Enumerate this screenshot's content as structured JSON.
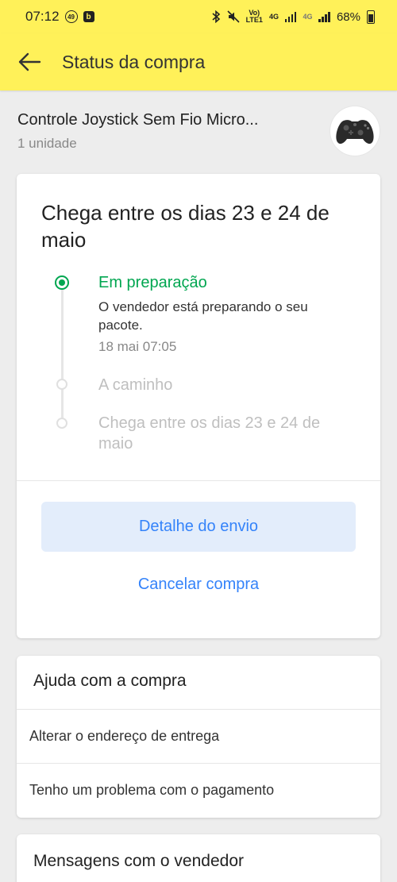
{
  "status_bar": {
    "time": "07:12",
    "notif_count": "49",
    "network_volte": "Vo)",
    "network_lte": "LTE1",
    "network_4g": "4G",
    "network_4g_secondary": "4G",
    "battery": "68%"
  },
  "header": {
    "title": "Status da compra",
    "background_color": "#fff159"
  },
  "product": {
    "name": "Controle Joystick Sem Fio Micro...",
    "quantity": "1 unidade"
  },
  "status": {
    "title": "Chega entre os dias 23 e 24 de maio",
    "steps": [
      {
        "title": "Em preparação",
        "description": "O vendedor está preparando o seu pacote.",
        "time": "18 mai 07:05",
        "state": "active"
      },
      {
        "title": "A caminho",
        "state": "pending"
      },
      {
        "title": "Chega entre os dias 23 e 24 de maio",
        "state": "pending"
      }
    ],
    "primary_button": "Detalhe do envio",
    "secondary_button": "Cancelar compra",
    "accent_color": "#3483fa",
    "success_color": "#00a650"
  },
  "help": {
    "title": "Ajuda com a compra",
    "items": [
      {
        "label": "Alterar o endereço de entrega"
      },
      {
        "label": "Tenho um problema com o pagamento"
      }
    ]
  },
  "messages": {
    "title": "Mensagens com o vendedor"
  }
}
